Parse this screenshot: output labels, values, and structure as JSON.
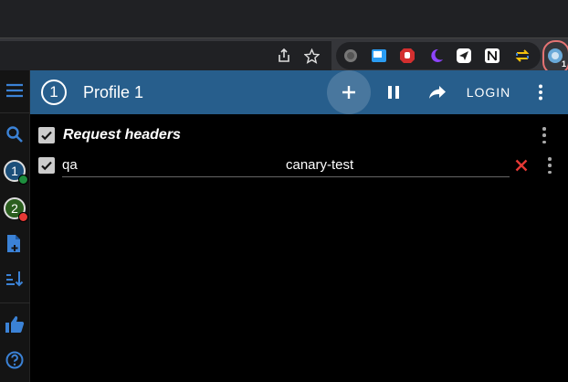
{
  "app": {
    "profile_number": "1",
    "profile_title": "Profile 1",
    "login_label": "LOGIN"
  },
  "sidebar": {
    "profiles": [
      {
        "number": "1",
        "status_color": "#1e8e3e"
      },
      {
        "number": "2",
        "status_color": "#e53935"
      }
    ]
  },
  "section": {
    "title": "Request headers",
    "checked": true
  },
  "headers": [
    {
      "name": "qa",
      "value": "canary-test",
      "enabled": true
    }
  ],
  "extension_badge": "1",
  "colors": {
    "header_bg": "#275e8c",
    "accent_blue": "#3b82d6",
    "remove_red": "#e53935"
  }
}
